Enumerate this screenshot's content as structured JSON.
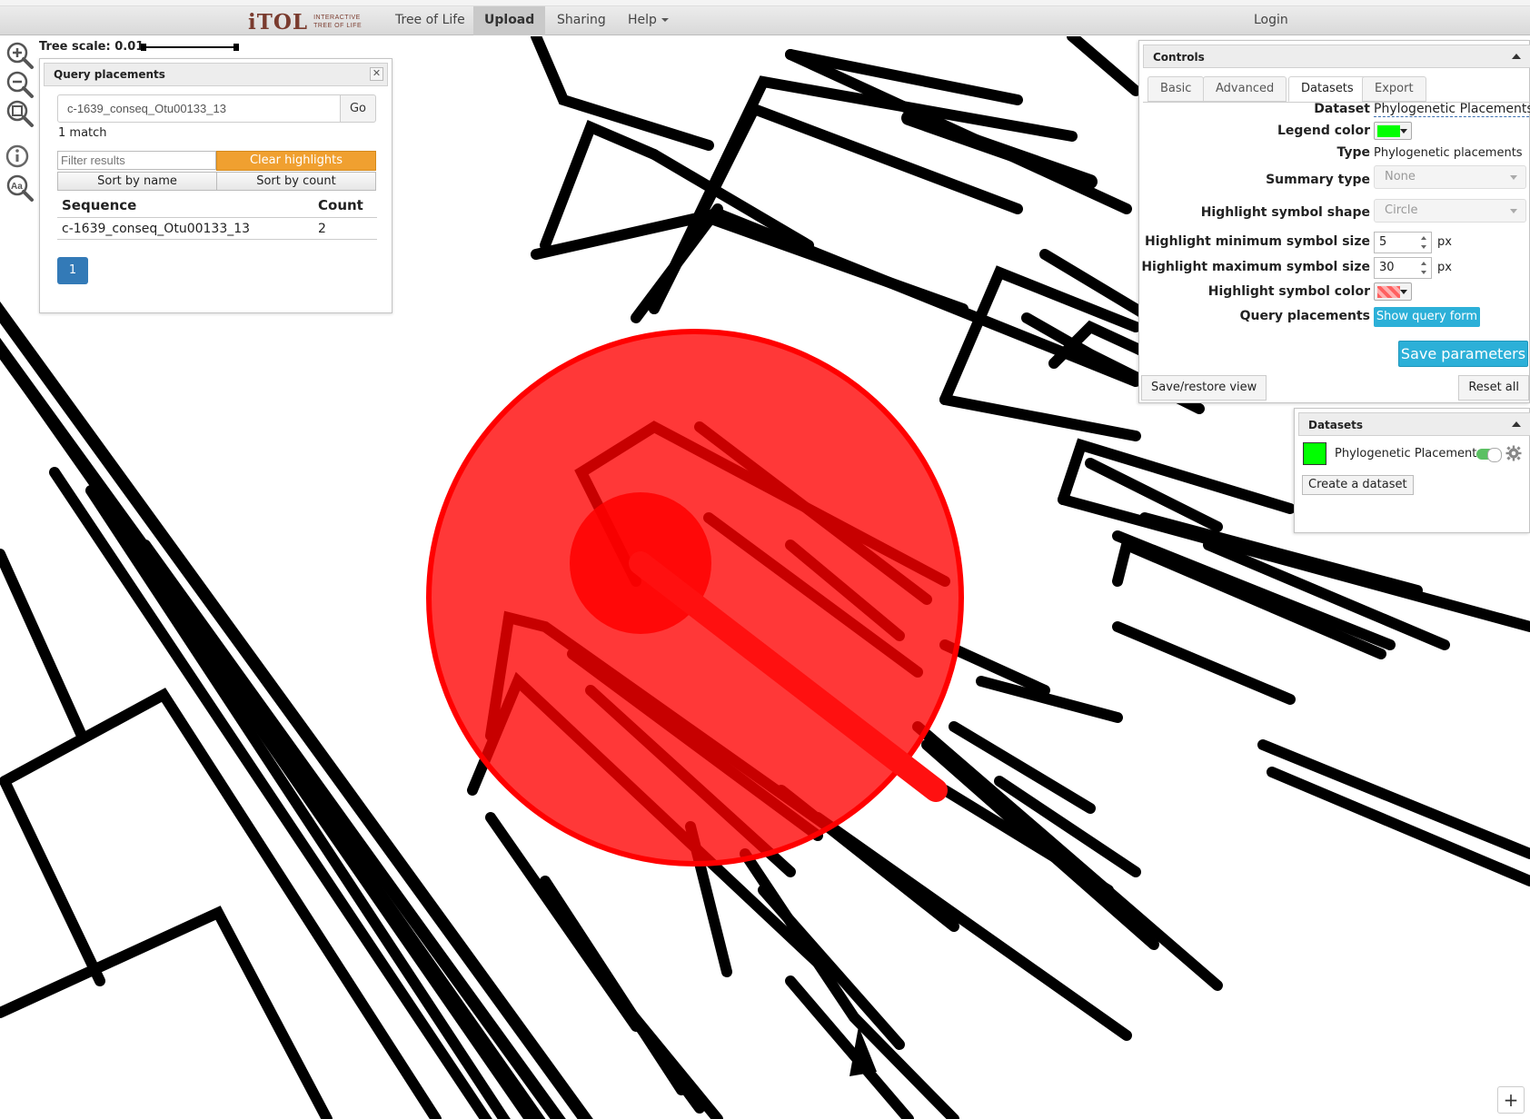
{
  "nav": {
    "logo_text": "iTOL",
    "logo_sub_1": "INTERACTIVE",
    "logo_sub_2": "TREE OF LIFE",
    "items": [
      {
        "label": "Tree of Life"
      },
      {
        "label": "Upload"
      },
      {
        "label": "Sharing"
      },
      {
        "label": "Help"
      }
    ],
    "login_label": "Login"
  },
  "tree_scale": {
    "label": "Tree scale: 0.01"
  },
  "tools": [
    "zoom-in-icon",
    "zoom-out-icon",
    "fit-view-icon",
    "info-icon",
    "font-size-icon"
  ],
  "query_panel": {
    "title": "Query placements",
    "close_icon": "close-icon",
    "search_value": "c-1639_conseq_Otu00133_13",
    "go_label": "Go",
    "match_text": "1 match",
    "filter_placeholder": "Filter results",
    "clear_label": "Clear highlights",
    "sort_name_label": "Sort by name",
    "sort_count_label": "Sort by count",
    "columns": [
      "Sequence",
      "Count"
    ],
    "rows": [
      {
        "sequence": "c-1639_conseq_Otu00133_13",
        "count": "2"
      }
    ],
    "page": "1"
  },
  "controls": {
    "title": "Controls",
    "tabs": [
      {
        "label": "Basic"
      },
      {
        "label": "Advanced"
      },
      {
        "label": "Datasets"
      },
      {
        "label": "Export"
      }
    ],
    "active_tab": "Datasets",
    "fields": {
      "dataset_label": "Dataset",
      "dataset_value": "Phylogenetic Placements",
      "legend_color_label": "Legend color",
      "legend_color": "#00ff00",
      "type_label": "Type",
      "type_value": "Phylogenetic placements",
      "summary_type_label": "Summary type",
      "summary_type_value": "None",
      "highlight_shape_label": "Highlight symbol shape",
      "highlight_shape_value": "Circle",
      "min_size_label": "Highlight minimum symbol size",
      "min_size_value": "5",
      "max_size_label": "Highlight maximum symbol size",
      "max_size_value": "30",
      "px_unit": "px",
      "symbol_color_label": "Highlight symbol color",
      "symbol_color": "#ff0000",
      "query_placements_label": "Query placements",
      "show_query_label": "Show query form"
    },
    "save_label": "Save parameters",
    "save_restore_label": "Save/restore view",
    "reset_label": "Reset all"
  },
  "datasets_panel": {
    "title": "Datasets",
    "items": [
      {
        "name": "Phylogenetic Placements",
        "color": "#00ff00",
        "enabled": true
      }
    ],
    "create_label": "Create a dataset"
  },
  "corner_button": "+"
}
